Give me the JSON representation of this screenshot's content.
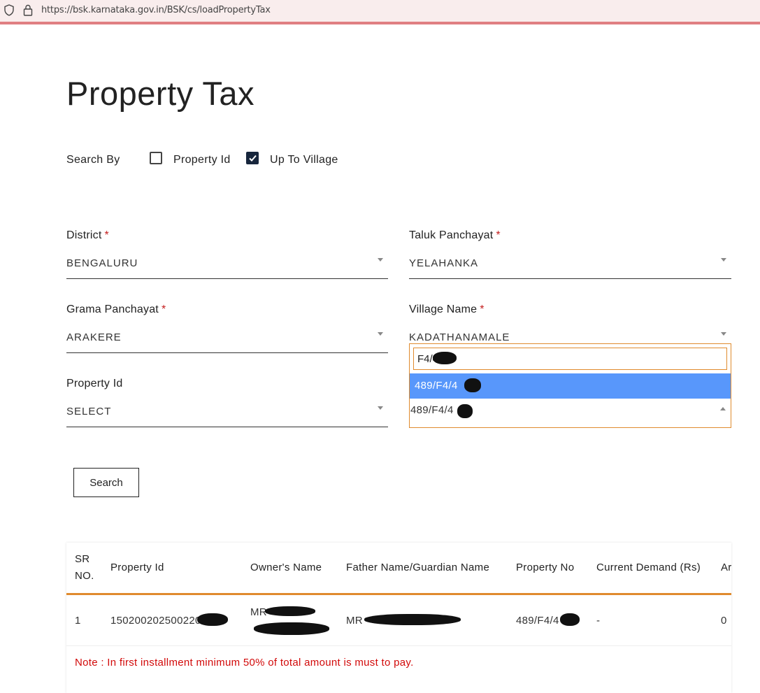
{
  "browser": {
    "url": "https://bsk.karnataka.gov.in/BSK/cs/loadPropertyTax"
  },
  "page": {
    "title": "Property Tax"
  },
  "search_by": {
    "label": "Search By",
    "options": [
      {
        "label": "Property Id",
        "checked": false
      },
      {
        "label": "Up To Village",
        "checked": true
      }
    ]
  },
  "form": {
    "district": {
      "label": "District",
      "value": "BENGALURU"
    },
    "taluk": {
      "label": "Taluk Panchayat",
      "value": "YELAHANKA"
    },
    "grama": {
      "label": "Grama Panchayat",
      "value": "ARAKERE"
    },
    "village": {
      "label": "Village Name",
      "value": "KADATHANAMALE"
    },
    "property_id": {
      "label": "Property Id",
      "value": "SELECT"
    },
    "required_mark": "*"
  },
  "dropdown": {
    "search_value": "F4/4",
    "highlighted_option": "489/F4/4",
    "selected_value": "489/F4/4"
  },
  "search_button": "Search",
  "table": {
    "columns": [
      "SR NO.",
      "Property Id",
      "Owner's Name",
      "Father Name/Guardian Name",
      "Property No",
      "Current Demand (Rs)",
      "Ar"
    ],
    "rows": [
      {
        "sr": "1",
        "property_id": "150200202500220",
        "owner": "MR",
        "father": "MR",
        "property_no": "489/F4/4",
        "current_demand": "-",
        "arrears": "0"
      }
    ],
    "note": "Note : In first installment minimum 50% of total amount is must to pay."
  },
  "colors": {
    "accent_orange": "#e08b2e",
    "highlight_blue": "#5897fb",
    "required_red": "#c41f1f",
    "note_red": "#d20a0a",
    "checkbox_navy": "#17263c"
  }
}
